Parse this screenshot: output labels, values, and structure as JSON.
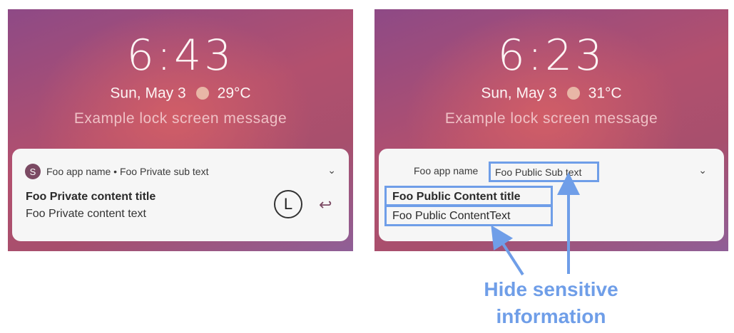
{
  "left": {
    "time": "6:43",
    "date": "Sun, May 3",
    "temp": "29°C",
    "message": "Example lock screen message",
    "notification": {
      "app_initial": "S",
      "header": "Foo app name • Foo Private sub text",
      "title": "Foo Private content title",
      "text": "Foo Private content text",
      "clock_icon": "clock-icon",
      "reply_icon": "reply-icon"
    }
  },
  "right": {
    "time": "6:23",
    "date": "Sun, May 3",
    "temp": "31°C",
    "message": "Example lock screen message",
    "notification": {
      "app_name": "Foo app name",
      "sub_text": "Foo Public Sub text",
      "title": "Foo Public Content title",
      "text": "Foo Public ContentText"
    }
  },
  "annotation": {
    "line1": "Hide sensitive",
    "line2": "information"
  },
  "colors": {
    "highlight": "#6f9ee8",
    "app_icon": "#7b4a63"
  }
}
